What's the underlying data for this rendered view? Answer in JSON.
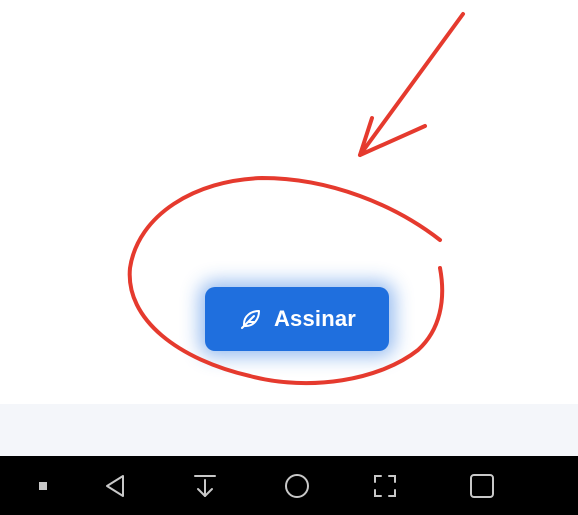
{
  "sign_button": {
    "label": "Assinar",
    "icon": "feather-icon",
    "color": "#1f6fde"
  },
  "annotation": {
    "color": "#e53a2e",
    "shapes": [
      "arrow",
      "circle"
    ]
  },
  "nav_bar": {
    "buttons": [
      "dot-icon",
      "back-triangle-icon",
      "download-arrow-icon",
      "home-circle-icon",
      "screenshot-frame-icon",
      "recents-square-icon"
    ]
  }
}
